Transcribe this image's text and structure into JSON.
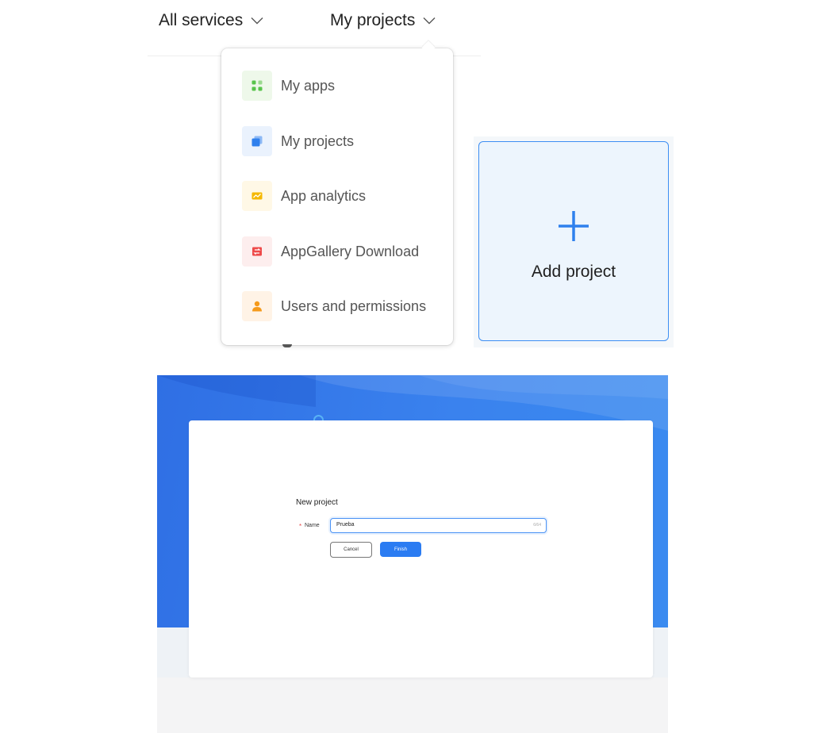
{
  "nav": {
    "all_services": "All services",
    "my_projects": "My projects"
  },
  "dropdown": {
    "items": [
      {
        "label": "My apps",
        "icon": "apps-grid-icon",
        "color": "#4fc24a"
      },
      {
        "label": "My projects",
        "icon": "projects-icon",
        "color": "#2f80ed"
      },
      {
        "label": "App analytics",
        "icon": "analytics-icon",
        "color": "#f5b800"
      },
      {
        "label": "AppGallery Download",
        "icon": "download-icon",
        "color": "#ee4a4a"
      },
      {
        "label": "Users and permissions",
        "icon": "user-icon",
        "color": "#f59a1b"
      }
    ]
  },
  "add_card": {
    "label": "Add project",
    "accent": "#3d8ef3"
  },
  "new_project": {
    "title": "New project",
    "required_mark": "*",
    "name_label": "Name",
    "name_value": "Prueba",
    "char_count": "6/64",
    "cancel_label": "Cancel",
    "finish_label": "Finish",
    "primary_color": "#2b7cf2"
  }
}
